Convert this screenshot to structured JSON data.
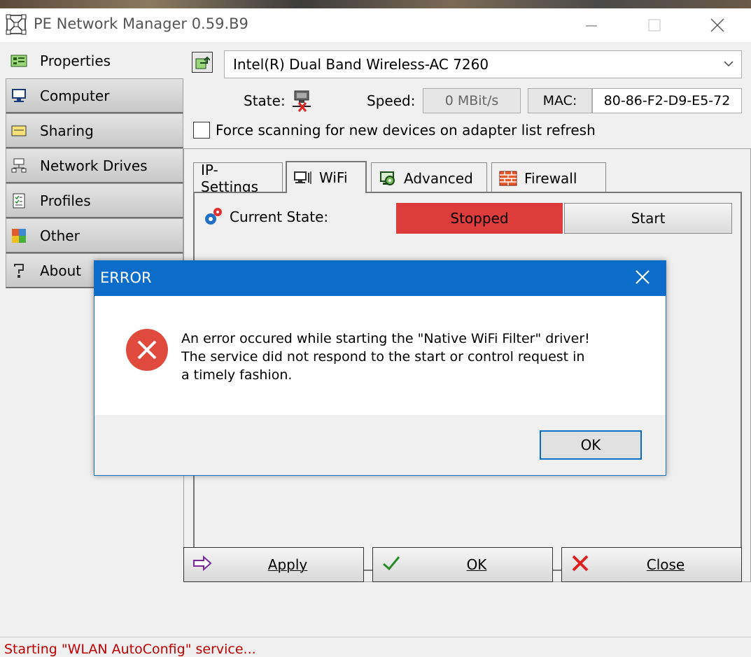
{
  "window": {
    "title": "PE Network Manager 0.59.B9"
  },
  "sidebar": {
    "items": [
      {
        "label": "Properties"
      },
      {
        "label": "Computer"
      },
      {
        "label": "Sharing"
      },
      {
        "label": "Network Drives"
      },
      {
        "label": "Profiles"
      },
      {
        "label": "Other"
      },
      {
        "label": "About"
      }
    ]
  },
  "adapter": {
    "selected": "Intel(R) Dual Band Wireless-AC 7260",
    "state_label": "State:",
    "speed_label": "Speed:",
    "speed_value": "0 MBit/s",
    "mac_label": "MAC:",
    "mac_value": "80-86-F2-D9-E5-72",
    "force_scan_label": "Force scanning for new devices on adapter list refresh"
  },
  "tabs": [
    {
      "label": "IP-Settings"
    },
    {
      "label": "WiFi"
    },
    {
      "label": "Advanced"
    },
    {
      "label": "Firewall"
    }
  ],
  "wifi": {
    "current_state_label": "Current State:",
    "status": "Stopped",
    "start_label": "Start"
  },
  "buttons": {
    "apply": "Apply",
    "ok": "OK",
    "close": "Close"
  },
  "status_text": "Starting \"WLAN AutoConfig\" service...",
  "dialog": {
    "title": "ERROR",
    "lines": [
      "An error occured while starting the \"Native WiFi Filter\" driver!",
      "The service did not respond to the start or control request in",
      "a timely fashion."
    ],
    "ok_label": "OK"
  },
  "colors": {
    "stopped_bg": "#dc3c3c",
    "dialog_accent": "#0b6dc9",
    "status_text": "#c00000"
  }
}
